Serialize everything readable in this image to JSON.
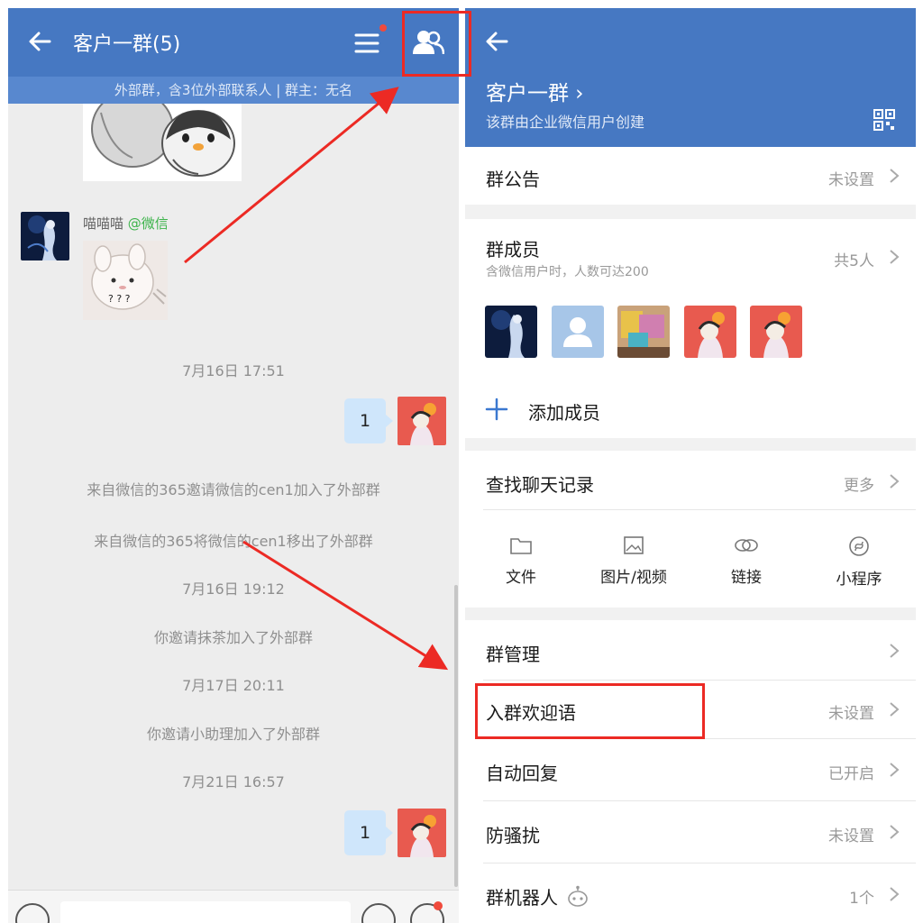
{
  "chat": {
    "title": "客户一群(5)",
    "subtitle": "外部群，含3位外部联系人 | 群主：无名",
    "sender": {
      "name": "喵喵喵",
      "tag": "@微信"
    },
    "rabbit_caption": "? ? ?",
    "messages": {
      "time1": "7月16日 17:51",
      "bubble1": "1",
      "sys1": "来自微信的365邀请微信的cen1加入了外部群",
      "sys2": "来自微信的365将微信的cen1移出了外部群",
      "time2": "7月16日 19:12",
      "sys3": "你邀请抹茶加入了外部群",
      "time3": "7月17日 20:11",
      "sys4": "你邀请小助理加入了外部群",
      "time4": "7月21日 16:57",
      "bubble2": "1"
    }
  },
  "settings": {
    "group_name": "客户一群 ›",
    "group_sub": "该群由企业微信用户创建",
    "announcement": {
      "label": "群公告",
      "value": "未设置"
    },
    "members": {
      "label": "群成员",
      "note": "含微信用户时，人数可达200",
      "value": "共5人"
    },
    "add_member": "添加成员",
    "search_history": {
      "label": "查找聊天记录",
      "value": "更多"
    },
    "quick": {
      "files": "文件",
      "images": "图片/视频",
      "links": "链接",
      "mini": "小程序"
    },
    "manage": {
      "label": "群管理"
    },
    "welcome": {
      "label": "入群欢迎语",
      "value": "未设置"
    },
    "auto_reply": {
      "label": "自动回复",
      "value": "已开启"
    },
    "anti_spam": {
      "label": "防骚扰",
      "value": "未设置"
    },
    "robot": {
      "label": "群机器人",
      "value": "1个"
    }
  },
  "colors": {
    "header": "#4678c2",
    "highlight": "#ec2a24",
    "bubble": "#cfe6fb"
  },
  "icons": [
    "back-arrow-icon",
    "menu-icon",
    "members-icon",
    "qr-code-icon",
    "plus-icon",
    "folder-icon",
    "image-icon",
    "link-icon",
    "mini-program-icon",
    "chevron-right-icon",
    "robot-icon",
    "voice-icon",
    "emoji-icon",
    "add-icon"
  ]
}
